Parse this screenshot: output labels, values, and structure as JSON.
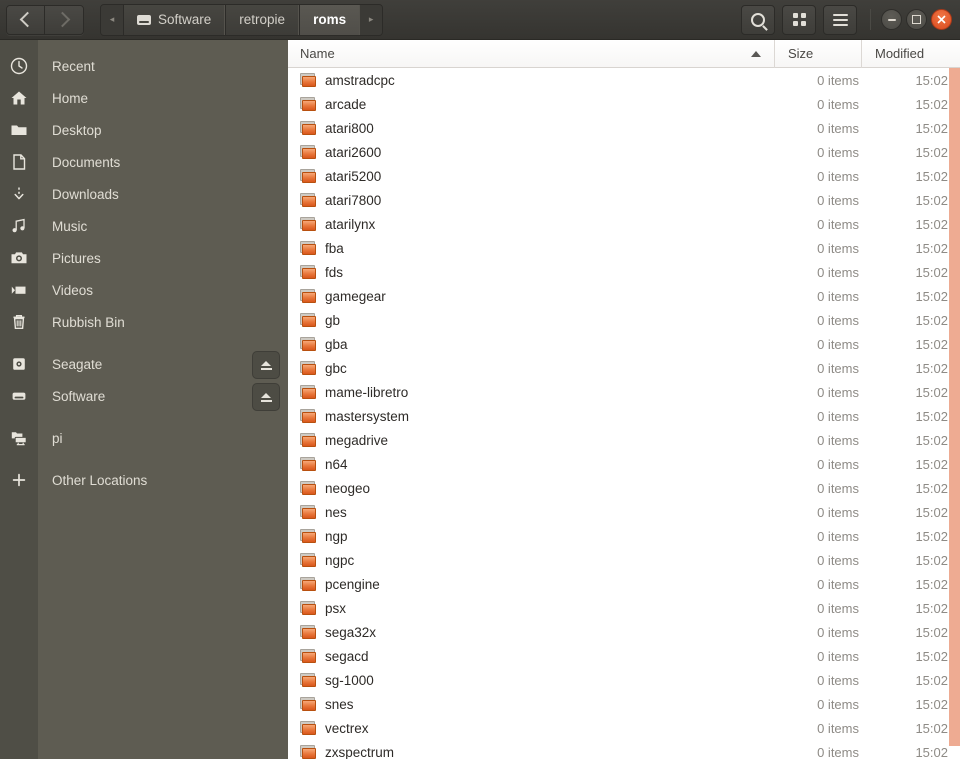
{
  "window": {
    "title": "roms",
    "nav": {
      "back_label": "Back",
      "forward_label": "Forward"
    },
    "toolbar": {
      "search_label": "Search",
      "view_label": "View options",
      "menu_label": "Menu"
    },
    "controls": {
      "minimize_label": "Minimize",
      "maximize_label": "Maximize",
      "close_label": "Close"
    }
  },
  "pathbar": {
    "prev_arrow": "◂",
    "next_arrow": "▸",
    "crumbs": [
      {
        "label": "Software",
        "icon": "drive-icon",
        "active": false
      },
      {
        "label": "retropie",
        "icon": "",
        "active": false
      },
      {
        "label": "roms",
        "icon": "",
        "active": true
      }
    ]
  },
  "sidebar": {
    "items": [
      {
        "label": "Recent",
        "icon": "clock-icon",
        "eject": false
      },
      {
        "label": "Home",
        "icon": "home-icon",
        "eject": false
      },
      {
        "label": "Desktop",
        "icon": "folder-icon",
        "eject": false
      },
      {
        "label": "Documents",
        "icon": "document-icon",
        "eject": false
      },
      {
        "label": "Downloads",
        "icon": "download-icon",
        "eject": false
      },
      {
        "label": "Music",
        "icon": "music-icon",
        "eject": false
      },
      {
        "label": "Pictures",
        "icon": "camera-icon",
        "eject": false
      },
      {
        "label": "Videos",
        "icon": "video-icon",
        "eject": false
      },
      {
        "label": "Rubbish Bin",
        "icon": "trash-icon",
        "eject": false
      },
      {
        "label": "Seagate",
        "icon": "harddisk-icon",
        "eject": true
      },
      {
        "label": "Software",
        "icon": "disk-icon",
        "eject": true
      },
      {
        "label": "pi",
        "icon": "network-folder-icon",
        "eject": false
      },
      {
        "label": "Other Locations",
        "icon": "plus-icon",
        "eject": false
      }
    ]
  },
  "filelist": {
    "columns": {
      "name": "Name",
      "size": "Size",
      "modified": "Modified"
    },
    "sort": {
      "column": "Name",
      "direction": "ascending"
    },
    "rows": [
      {
        "name": "amstradcpc",
        "size": "0 items",
        "modified": "15:02"
      },
      {
        "name": "arcade",
        "size": "0 items",
        "modified": "15:02"
      },
      {
        "name": "atari800",
        "size": "0 items",
        "modified": "15:02"
      },
      {
        "name": "atari2600",
        "size": "0 items",
        "modified": "15:02"
      },
      {
        "name": "atari5200",
        "size": "0 items",
        "modified": "15:02"
      },
      {
        "name": "atari7800",
        "size": "0 items",
        "modified": "15:02"
      },
      {
        "name": "atarilynx",
        "size": "0 items",
        "modified": "15:02"
      },
      {
        "name": "fba",
        "size": "0 items",
        "modified": "15:02"
      },
      {
        "name": "fds",
        "size": "0 items",
        "modified": "15:02"
      },
      {
        "name": "gamegear",
        "size": "0 items",
        "modified": "15:02"
      },
      {
        "name": "gb",
        "size": "0 items",
        "modified": "15:02"
      },
      {
        "name": "gba",
        "size": "0 items",
        "modified": "15:02"
      },
      {
        "name": "gbc",
        "size": "0 items",
        "modified": "15:02"
      },
      {
        "name": "mame-libretro",
        "size": "0 items",
        "modified": "15:02"
      },
      {
        "name": "mastersystem",
        "size": "0 items",
        "modified": "15:02"
      },
      {
        "name": "megadrive",
        "size": "0 items",
        "modified": "15:02"
      },
      {
        "name": "n64",
        "size": "0 items",
        "modified": "15:02"
      },
      {
        "name": "neogeo",
        "size": "0 items",
        "modified": "15:02"
      },
      {
        "name": "nes",
        "size": "0 items",
        "modified": "15:02"
      },
      {
        "name": "ngp",
        "size": "0 items",
        "modified": "15:02"
      },
      {
        "name": "ngpc",
        "size": "0 items",
        "modified": "15:02"
      },
      {
        "name": "pcengine",
        "size": "0 items",
        "modified": "15:02"
      },
      {
        "name": "psx",
        "size": "0 items",
        "modified": "15:02"
      },
      {
        "name": "sega32x",
        "size": "0 items",
        "modified": "15:02"
      },
      {
        "name": "segacd",
        "size": "0 items",
        "modified": "15:02"
      },
      {
        "name": "sg-1000",
        "size": "0 items",
        "modified": "15:02"
      },
      {
        "name": "snes",
        "size": "0 items",
        "modified": "15:02"
      },
      {
        "name": "vectrex",
        "size": "0 items",
        "modified": "15:02"
      },
      {
        "name": "zxspectrum",
        "size": "0 items",
        "modified": "15:02"
      }
    ]
  },
  "colors": {
    "headerbar": "#3c3b37",
    "sidebar": "#5e5c52",
    "icon_strip": "#4f4e46",
    "folder_orange": "#e8763a",
    "close_button": "#e84f1c",
    "scrollbar_thumb": "#eeab92"
  }
}
